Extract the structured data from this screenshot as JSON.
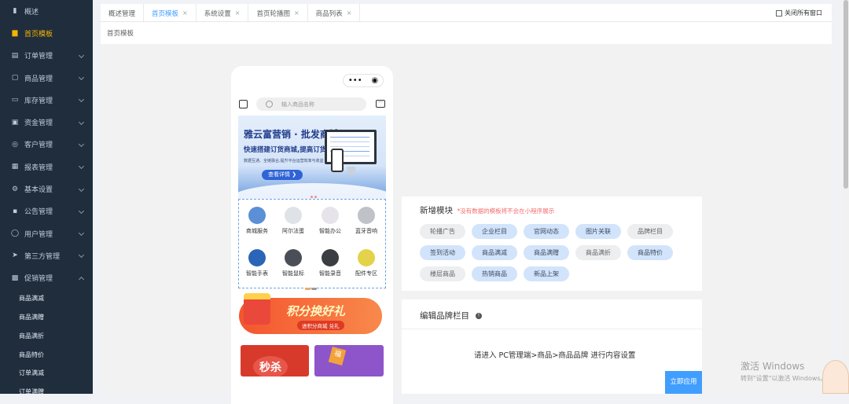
{
  "sidebar": {
    "items": [
      {
        "label": "概述",
        "icon": "chart-icon",
        "active": false,
        "chevron": false
      },
      {
        "label": "首页模板",
        "icon": "template-icon",
        "active": true,
        "chevron": false
      },
      {
        "label": "订单管理",
        "icon": "order-icon",
        "active": false,
        "chevron": true
      },
      {
        "label": "商品管理",
        "icon": "goods-icon",
        "active": false,
        "chevron": true
      },
      {
        "label": "库存管理",
        "icon": "inventory-icon",
        "active": false,
        "chevron": true
      },
      {
        "label": "资金管理",
        "icon": "funds-icon",
        "active": false,
        "chevron": true
      },
      {
        "label": "客户管理",
        "icon": "customer-icon",
        "active": false,
        "chevron": true
      },
      {
        "label": "报表管理",
        "icon": "report-icon",
        "active": false,
        "chevron": true
      },
      {
        "label": "基本设置",
        "icon": "settings-icon",
        "active": false,
        "chevron": true
      },
      {
        "label": "公告管理",
        "icon": "notice-icon",
        "active": false,
        "chevron": true
      },
      {
        "label": "用户管理",
        "icon": "user-icon",
        "active": false,
        "chevron": true
      },
      {
        "label": "第三方管理",
        "icon": "send-icon",
        "active": false,
        "chevron": true
      },
      {
        "label": "促销管理",
        "icon": "promotion-icon",
        "active": false,
        "chevron": true,
        "expanded": true
      }
    ],
    "subitems": [
      "商品满减",
      "商品满赠",
      "商品满折",
      "商品特价",
      "订单满减",
      "订单满赠"
    ]
  },
  "tabs": [
    {
      "label": "概述管理",
      "active": false,
      "closable": false
    },
    {
      "label": "首页模板",
      "active": true,
      "closable": true
    },
    {
      "label": "系统设置",
      "active": false,
      "closable": true
    },
    {
      "label": "首页轮播图",
      "active": false,
      "closable": true
    },
    {
      "label": "商品列表",
      "active": false,
      "closable": true
    }
  ],
  "tab_close_glyph": "×",
  "close_all_label": "关闭所有窗口",
  "breadcrumb": "首页模板",
  "phone": {
    "search_placeholder": "输入商品名称",
    "banner": {
      "title": "雅云富营销 · 批发商城",
      "subtitle": "快速搭建订货商城,提高订货效率",
      "desc": "数据互通、全链融合,提升平台运营效率与收益",
      "button": "查看详情 ❯"
    },
    "grid_items": [
      {
        "label": "商城服务",
        "icon": "bird-icon",
        "color": "#5b8fd6"
      },
      {
        "label": "阿尔法蛋",
        "icon": "robot-icon",
        "color": "#dfe3e8"
      },
      {
        "label": "智能办公",
        "icon": "cube-icon",
        "color": "#e6e3ea"
      },
      {
        "label": "蓝牙音响",
        "icon": "speaker-icon",
        "color": "#bfc3c8"
      },
      {
        "label": "智能手表",
        "icon": "watch-icon",
        "color": "#2a65b8"
      },
      {
        "label": "智能鼠标",
        "icon": "mouse-icon",
        "color": "#4a4f57"
      },
      {
        "label": "智能录音",
        "icon": "recorder-icon",
        "color": "#3a3d42"
      },
      {
        "label": "配件专区",
        "icon": "cable-icon",
        "color": "#e3d24a"
      }
    ],
    "points_title": "积分换好礼",
    "points_sub": "进积分商城 兑礼",
    "promo_left": "秒杀",
    "promo_right": "福"
  },
  "new_module": {
    "title": "新增模块",
    "note": "*没有数据的模板将不会在小程序展示",
    "chips": [
      {
        "label": "轮播广告",
        "style": "gray"
      },
      {
        "label": "企业栏目",
        "style": "blue"
      },
      {
        "label": "官网动态",
        "style": "blue"
      },
      {
        "label": "图片关联",
        "style": "blue"
      },
      {
        "label": "品牌栏目",
        "style": "gray"
      },
      {
        "label": "签到活动",
        "style": "blue"
      },
      {
        "label": "商品满减",
        "style": "blue"
      },
      {
        "label": "商品满赠",
        "style": "blue"
      },
      {
        "label": "商品满折",
        "style": "gray"
      },
      {
        "label": "商品特价",
        "style": "blue"
      },
      {
        "label": "楼层商品",
        "style": "gray"
      },
      {
        "label": "热销商品",
        "style": "blue"
      },
      {
        "label": "新品上架",
        "style": "blue"
      }
    ]
  },
  "brand_panel": {
    "title": "编辑品牌栏目",
    "message": "请进入 PC管理端>商品>商品品牌 进行内容设置"
  },
  "apply_button": "立即应用",
  "watermark": {
    "line1": "激活 Windows",
    "line2": "转到\"设置\"以激活 Windows。"
  },
  "colors": {
    "sidebar_bg": "#1f2d3d",
    "active_menu": "#f5b400",
    "accent": "#409eff",
    "note_red": "#f56c6c"
  }
}
